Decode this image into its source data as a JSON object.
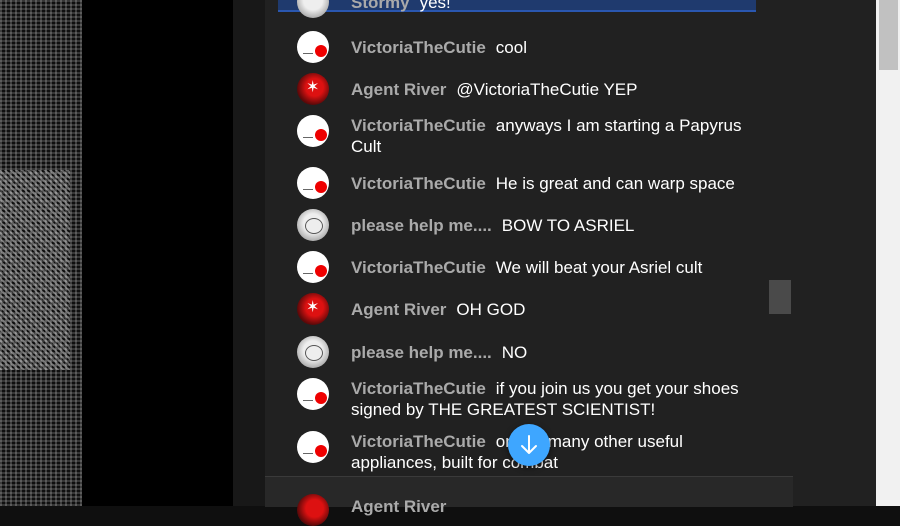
{
  "messages": [
    {
      "author": "Stormy",
      "text": "yes!",
      "avatar": "default"
    },
    {
      "author": "VictoriaTheCutie",
      "text": "cool",
      "avatar": "white-red-dot"
    },
    {
      "author": "Agent River",
      "text": "@VictoriaTheCutie YEP",
      "avatar": "spiderman-red"
    },
    {
      "author": "VictoriaTheCutie",
      "text": "anyways I am starting a Papyrus Cult",
      "avatar": "white-red-dot"
    },
    {
      "author": "VictoriaTheCutie",
      "text": "He is great and can warp space",
      "avatar": "white-red-dot"
    },
    {
      "author": "please help me....",
      "text": "BOW TO ASRIEL",
      "avatar": "anime-gray"
    },
    {
      "author": "VictoriaTheCutie",
      "text": "We will beat your Asriel cult",
      "avatar": "white-red-dot"
    },
    {
      "author": "Agent River",
      "text": "OH GOD",
      "avatar": "spiderman-red"
    },
    {
      "author": "please help me....",
      "text": "NO",
      "avatar": "anime-gray"
    },
    {
      "author": "VictoriaTheCutie",
      "text": "if you join us you get your shoes signed by THE GREATEST SCIENTIST!",
      "avatar": "white-red-dot"
    },
    {
      "author": "VictoriaTheCutie",
      "text": "one of many other useful appliances, built for combat",
      "avatar": "white-red-dot"
    }
  ],
  "next_author": "Agent River",
  "scroll_button_icon": "arrow-down-icon",
  "colors": {
    "panel": "#212121",
    "author": "#aaaaaa",
    "fab": "#3ea6ff"
  }
}
